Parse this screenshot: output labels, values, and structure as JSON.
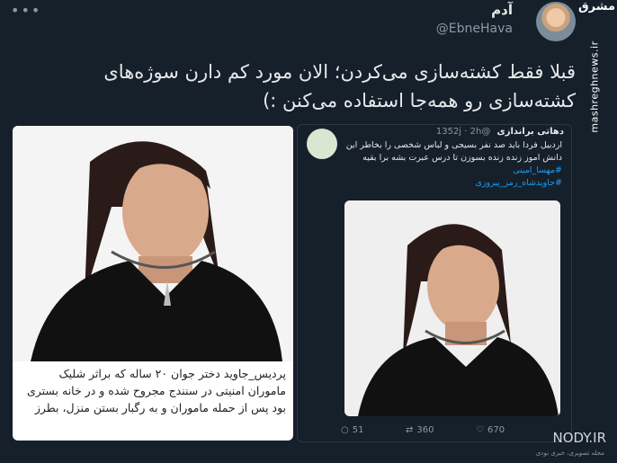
{
  "header": {
    "name": "آدم",
    "handle": "@EbneHava",
    "watermark_top": "مشرق",
    "watermark_side": "mashreghnews.ir"
  },
  "tweet": {
    "text": "قبلا فقط کشته‌سازی می‌کردن؛ الان مورد کم دارن سوژه‌های کشته‌سازی رو همه‌جا استفاده می‌کنن :)"
  },
  "left_card": {
    "caption": "پردیس_جاوید دختر جوان ۲۰ ساله که براثر شلیک ماموران امنیتی در سنندج مجروح شده و در خانه بستری بود پس از حمله ماموران و به رگبار بستن منزل، بطرز"
  },
  "embedded_tweet": {
    "name": "دهاتی براندازی",
    "handle": "@1352j",
    "time": "2h",
    "text": "اردبیل فردا باید صد نفر بسیجی و لباس شخصی را بخاطر این دانش اموز زنده زنده بسوزن تا درس عبرت بشه برا بقیه",
    "hashtags": [
      "#مهسا_امینی",
      "#جاویدشاه_رمز_پیروزی"
    ],
    "replies": "51",
    "retweets": "360",
    "likes": "670"
  },
  "footer": {
    "brand": "NODY.IR",
    "brand_sub": "مجله تصویری، خبری نودی"
  }
}
